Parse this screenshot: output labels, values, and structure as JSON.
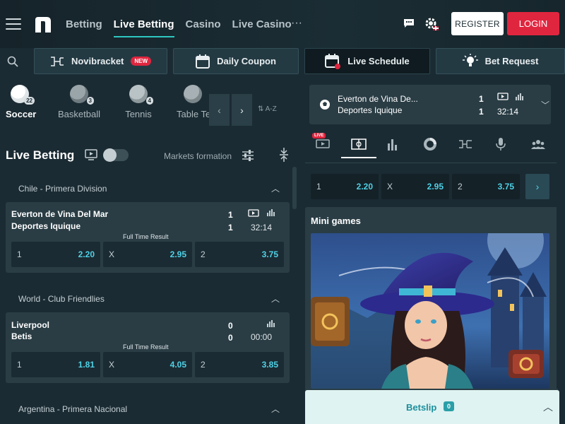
{
  "header": {
    "nav": [
      "Betting",
      "Live Betting",
      "Casino",
      "Live Casino"
    ],
    "more": "···",
    "register_label": "REGISTER",
    "login_label": "LOGIN"
  },
  "quick_links": [
    {
      "label": "Novibracket",
      "badge": "NEW",
      "icon": "bracket-icon"
    },
    {
      "label": "Daily Coupon",
      "icon": "calendar-icon"
    },
    {
      "label": "Live Schedule",
      "icon": "calendar-live-icon"
    },
    {
      "label": "Bet Request",
      "icon": "lightbulb-icon"
    }
  ],
  "sports": [
    {
      "label": "Soccer",
      "count": "22"
    },
    {
      "label": "Basketball",
      "count": "3"
    },
    {
      "label": "Tennis",
      "count": "4"
    },
    {
      "label": "Table Te",
      "count": ""
    }
  ],
  "sort_label": "A-Z",
  "live_betting": {
    "title": "Live Betting",
    "markets_formation": "Markets formation"
  },
  "leagues": [
    {
      "name": "Chile - Primera Division",
      "match": {
        "home": "Everton de Vina Del Mar",
        "away": "Deportes Iquique",
        "home_score": "1",
        "away_score": "1",
        "time": "32:14",
        "market": "Full Time Result",
        "odds": [
          {
            "label": "1",
            "value": "2.20"
          },
          {
            "label": "X",
            "value": "2.95"
          },
          {
            "label": "2",
            "value": "3.75"
          }
        ]
      }
    },
    {
      "name": "World - Club Friendlies",
      "match": {
        "home": "Liverpool",
        "away": "Betis",
        "home_score": "0",
        "away_score": "0",
        "time": "00:00",
        "market": "Full Time Result",
        "odds": [
          {
            "label": "1",
            "value": "1.81"
          },
          {
            "label": "X",
            "value": "4.05"
          },
          {
            "label": "2",
            "value": "3.85"
          }
        ]
      }
    },
    {
      "name": "Argentina - Primera Nacional"
    }
  ],
  "featured": {
    "home": "Everton de Vina De...",
    "away": "Deportes Iquique",
    "home_score": "1",
    "away_score": "1",
    "time": "32:14",
    "live_badge": "LIVE",
    "odds": [
      {
        "label": "1",
        "value": "2.20"
      },
      {
        "label": "X",
        "value": "2.95"
      },
      {
        "label": "2",
        "value": "3.75"
      }
    ]
  },
  "mini_games": {
    "title": "Mini games"
  },
  "betslip": {
    "label": "Betslip",
    "count": "0"
  },
  "colors": {
    "accent": "#2ec7c1",
    "odds": "#4fd1e6",
    "login": "#e0263f"
  }
}
